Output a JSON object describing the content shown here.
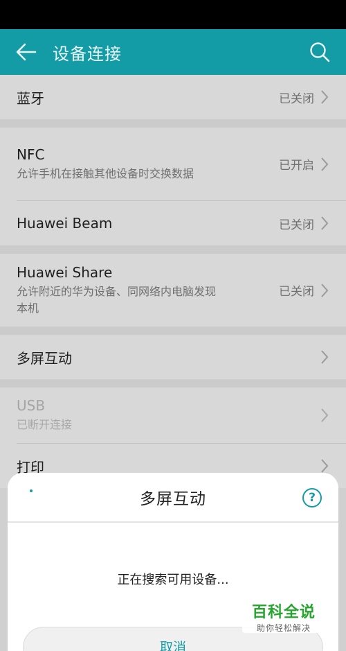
{
  "app_bar": {
    "title": "设备连接",
    "back_icon": "arrow-left-icon",
    "search_icon": "search-icon"
  },
  "groups": [
    {
      "items": [
        {
          "title": "蓝牙",
          "status": "已关闭"
        }
      ]
    },
    {
      "items": [
        {
          "title": "NFC",
          "subtitle": "允许手机在接触其他设备时交换数据",
          "status": "已开启"
        },
        {
          "title": "Huawei Beam",
          "status": "已关闭"
        }
      ]
    },
    {
      "items": [
        {
          "title": "Huawei Share",
          "subtitle": "允许附近的华为设备、同网络内电脑发现本机",
          "status": "已关闭"
        }
      ]
    },
    {
      "items": [
        {
          "title": "多屏互动"
        }
      ]
    },
    {
      "items": [
        {
          "title": "USB",
          "subtitle": "已断开连接",
          "disabled": true
        },
        {
          "title": "打印"
        }
      ]
    }
  ],
  "dialog": {
    "title": "多屏互动",
    "help_label": "?",
    "message": "正在搜索可用设备...",
    "cancel_label": "取消"
  },
  "watermark": {
    "main": "百科全说",
    "sub": "助你轻松解决"
  },
  "colors": {
    "accent": "#139ba6",
    "watermark": "#27a62f"
  }
}
